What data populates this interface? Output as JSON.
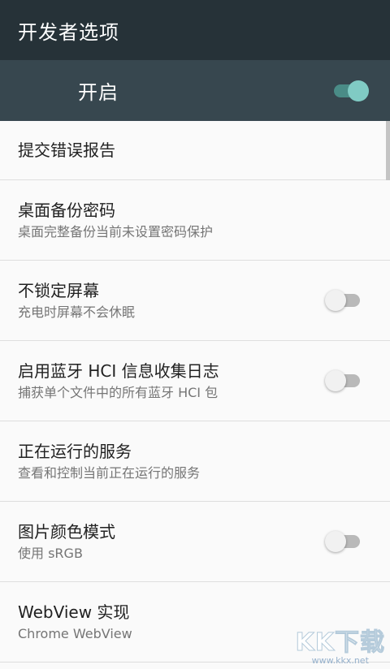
{
  "appbar": {
    "title": "开发者选项"
  },
  "master": {
    "label": "开启",
    "enabled": true
  },
  "items": [
    {
      "title": "提交错误报告",
      "summary": "",
      "has_switch": false
    },
    {
      "title": "桌面备份密码",
      "summary": "桌面完整备份当前未设置密码保护",
      "has_switch": false
    },
    {
      "title": "不锁定屏幕",
      "summary": "充电时屏幕不会休眠",
      "has_switch": true,
      "checked": false
    },
    {
      "title": "启用蓝牙 HCI 信息收集日志",
      "summary": "捕获单个文件中的所有蓝牙 HCI 包",
      "has_switch": true,
      "checked": false
    },
    {
      "title": "正在运行的服务",
      "summary": "查看和控制当前正在运行的服务",
      "has_switch": false
    },
    {
      "title": "图片颜色模式",
      "summary": "使用 sRGB",
      "has_switch": true,
      "checked": false
    },
    {
      "title": "WebView 实现",
      "summary": "Chrome WebView",
      "has_switch": false
    }
  ],
  "watermark": {
    "logo": "KK下载",
    "url": "www.kkx.net"
  },
  "colors": {
    "appbar": "#263238",
    "master_bar": "#37474f",
    "accent": "#80cbc4",
    "background": "#fafafa"
  }
}
